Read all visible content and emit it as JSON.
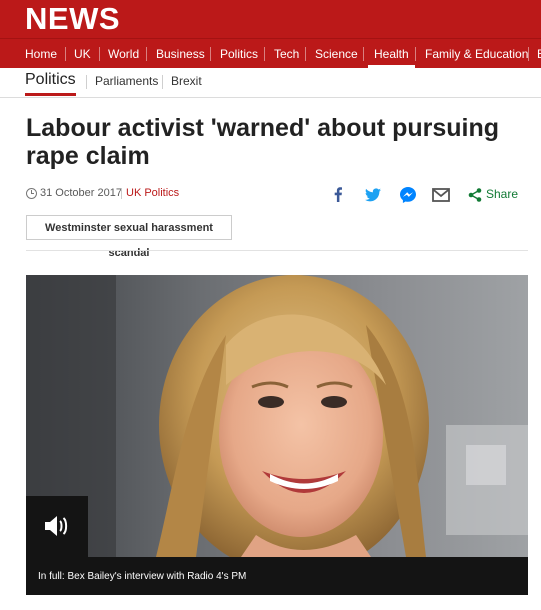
{
  "brand": {
    "logo_text": "NEWS",
    "primary_color": "#bb1919"
  },
  "nav": {
    "items": [
      {
        "label": "Home"
      },
      {
        "label": "UK"
      },
      {
        "label": "World"
      },
      {
        "label": "Business"
      },
      {
        "label": "Politics"
      },
      {
        "label": "Tech"
      },
      {
        "label": "Science"
      },
      {
        "label": "Health",
        "active": true
      },
      {
        "label": "Family & Education"
      },
      {
        "label": "E"
      }
    ]
  },
  "section": {
    "title": "Politics",
    "links": [
      "Parliaments",
      "Brexit"
    ]
  },
  "article": {
    "headline": "Labour activist 'warned' about pursuing rape claim",
    "date": "31 October 2017",
    "topic": "UK Politics",
    "tag": "Westminster sexual harassment scandal",
    "media": {
      "play_icon": "speaker-icon",
      "caption": "In full: Bex Bailey's interview with Radio 4's PM"
    }
  },
  "share": {
    "label": "Share",
    "icons": [
      "facebook-icon",
      "twitter-icon",
      "messenger-icon",
      "email-icon",
      "share-icon"
    ],
    "facebook_color": "#3b5998",
    "twitter_color": "#1da1f2",
    "messenger_color": "#0084ff",
    "share_color": "#127a35"
  }
}
